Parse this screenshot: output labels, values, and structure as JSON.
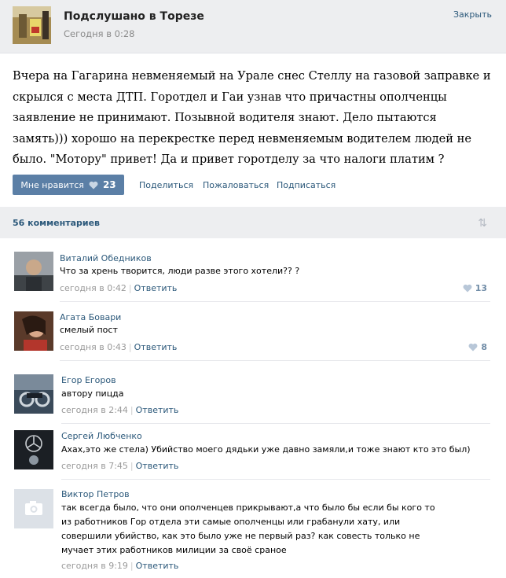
{
  "header": {
    "title": "Подслушано в Торезе",
    "time": "Сегодня в 0:28",
    "close_label": "Закрыть"
  },
  "post": {
    "text": "Вчера на Гагарина невменяемый на Урале снес Стеллу на газовой заправке и скрылся с места ДТП. Горотдел и Гаи узнав что причастны ополченцы заявление не принимают. Позывной водителя знают. Дело пытаются замять))) хорошо на перекрестке перед невменяемым водителем людей не было. \"Мотору\" привет! Да и привет горотделу за что налоги платим ?"
  },
  "actions": {
    "like_label": "Мне нравится",
    "like_count": "23",
    "share_label": "Поделиться",
    "report_label": "Пожаловаться",
    "subscribe_label": "Подписаться"
  },
  "comments_header": {
    "count_label": "56 комментариев"
  },
  "comments": [
    {
      "name": "Виталий Обедников",
      "text": "Что за хрень творится, люди разве этого хотели?? ?",
      "time": "сегодня в 0:42",
      "reply": "Ответить",
      "likes": "13"
    },
    {
      "name": "Агата Бовари",
      "text": "смелый пост",
      "time": "сегодня в 0:43",
      "reply": "Ответить",
      "likes": "8"
    },
    {
      "name": "Егор Егоров",
      "text": "автору пицда",
      "time": "сегодня в 2:44",
      "reply": "Ответить",
      "likes": ""
    },
    {
      "name": "Сергей Любченко",
      "text": "Ахах,это же стела) Убийство моего дядьки уже давно замяли,и тоже знают кто это был)",
      "time": "сегодня в 7:45",
      "reply": "Ответить",
      "likes": ""
    },
    {
      "name": "Виктор Петров",
      "text": "так всегда было, что они ополченцев прикрывают,а что было бы если бы кого то из работников Гор отдела эти самые ополченцы или грабанули хату, или совершили убийство, как это было уже не первый раз? как совесть только не мучает этих работников милиции за своё сраное",
      "time": "сегодня в 9:19",
      "reply": "Ответить",
      "likes": ""
    }
  ],
  "colors": {
    "link": "#2b587a",
    "like_button": "#5b7fa6",
    "header_bg": "#edeef0"
  }
}
